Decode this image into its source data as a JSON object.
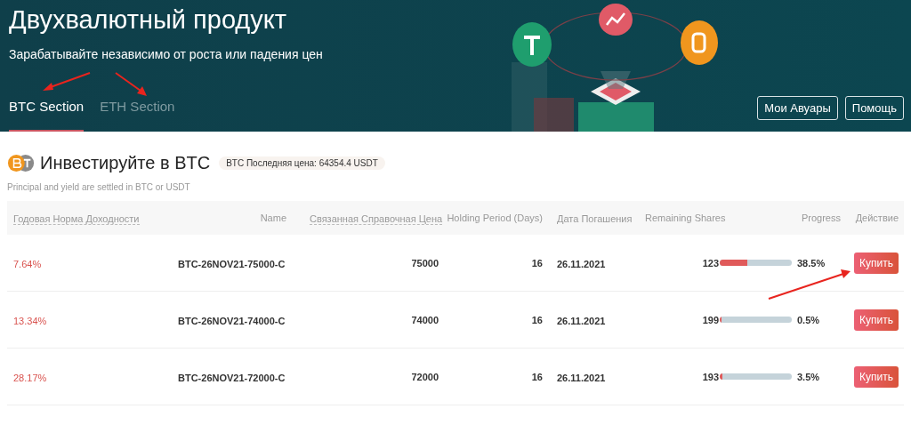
{
  "header": {
    "title": "Двухвалютный продукт",
    "subtitle": "Зарабатывайте независимо от роста или падения цен",
    "tabs": [
      {
        "label": "BTC Section",
        "selected": true
      },
      {
        "label": "ETH Section",
        "selected": false
      }
    ],
    "buttons": [
      "Мои Авуары",
      "Помощь"
    ]
  },
  "section": {
    "title": "Инвестируйте в BTC",
    "price_badge": "BTC Последняя цена: 64354.4 USDT",
    "note": "Principal and yield are settled in BTC or USDT"
  },
  "table": {
    "columns": [
      {
        "label": "Годовая Норма Доходности",
        "sortable": true
      },
      {
        "label": "Name",
        "sortable": false
      },
      {
        "label": "Связанная Справочная Цена",
        "sortable": true
      },
      {
        "label": "Holding Period (Days)",
        "sortable": false
      },
      {
        "label": "Дата Погашения",
        "sortable": false
      },
      {
        "label": "Remaining Shares",
        "sortable": false
      },
      {
        "label": "Progress",
        "sortable": false
      },
      {
        "label": "Действие",
        "sortable": false
      }
    ],
    "rows": [
      {
        "apy": "7.64%",
        "name": "BTC-26NOV21-75000-C",
        "price": "75000",
        "days": "16",
        "date": "26.11.2021",
        "shares": "123",
        "level": 0.385,
        "progress": "38.5%",
        "action": "Купить"
      },
      {
        "apy": "13.34%",
        "name": "BTC-26NOV21-74000-C",
        "price": "74000",
        "days": "16",
        "date": "26.11.2021",
        "shares": "199",
        "level": 0.005,
        "progress": "0.5%",
        "action": "Купить"
      },
      {
        "apy": "28.17%",
        "name": "BTC-26NOV21-72000-C",
        "price": "72000",
        "days": "16",
        "date": "26.11.2021",
        "shares": "193",
        "level": 0.035,
        "progress": "3.5%",
        "action": "Купить"
      }
    ]
  }
}
